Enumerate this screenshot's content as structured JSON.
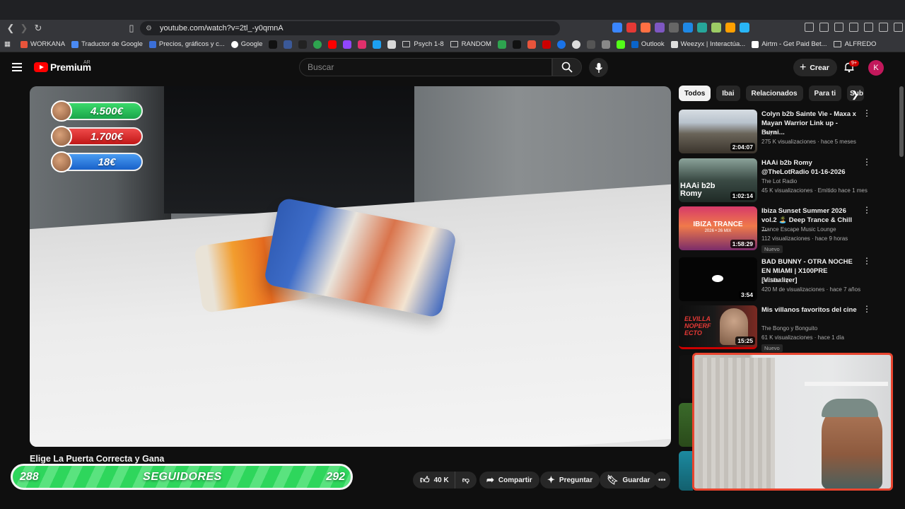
{
  "browser": {
    "url": "youtube.com/watch?v=2tl_-y0qmnA",
    "bookmarks": [
      {
        "label": "WORKANA",
        "color": "#e8543b"
      },
      {
        "label": "Traductor de Google",
        "color": "#4a8af4"
      },
      {
        "label": "Precios, gráficos y c...",
        "color": "#3b6fd8"
      },
      {
        "label": "Google",
        "color": "#ffffff"
      }
    ],
    "bookmark_icons": [
      "#000000",
      "#3b5998",
      "#111111",
      "#2ea44f",
      "#ff0000",
      "#9146ff",
      "#e1306c",
      "#1da1f2",
      "#d9d9d9"
    ],
    "bookmark_folder_1": "Psych 1-8",
    "bookmark_folder_2": "RANDOM",
    "bookmark_icons_2": [
      "#2ea44f",
      "#111111",
      "#e8543b",
      "#cc0000",
      "#1a73e8",
      "#dddddd",
      "#555555",
      "#888888",
      "#53fc18"
    ],
    "outlook": "Outlook",
    "weezyx": "Weezyx | Interactúa...",
    "airtm": "Airtm - Get Paid Bet...",
    "alfredo": "ALFREDO"
  },
  "header": {
    "logo": "Premium",
    "country": "AR",
    "search_placeholder": "Buscar",
    "create": "Crear",
    "notifications": "9+",
    "avatar_letter": "K"
  },
  "video": {
    "title": "Elige La Puerta Correcta y Gana",
    "scores": [
      "4.500€",
      "1.700€",
      "18€"
    ],
    "followers_left": "288",
    "followers_label": "SEGUIDORES",
    "followers_right": "292",
    "likes": "40 K",
    "share": "Compartir",
    "ask": "Preguntar",
    "save": "Guardar"
  },
  "chips": [
    "Todos",
    "Ibai",
    "Relacionados",
    "Para ti",
    "Sub"
  ],
  "recommendations": [
    {
      "title": "Colyn b2b Sainte Vie - Maxa x Mayan Warrior Link up - Burni...",
      "channel": "Colyn",
      "meta": "275 K visualizaciones · hace 5 meses",
      "duration": "2:04:07",
      "badge": ""
    },
    {
      "title": "HAAi b2b Romy @TheLotRadio 01-16-2026",
      "channel": "The Lot Radio",
      "meta": "45 K visualizaciones · Emitido hace 1 mes",
      "duration": "1:02:14",
      "badge": ""
    },
    {
      "title": "Ibiza Sunset Summer 2026 vol.2 🏝️ Deep Trance & Chill ...",
      "channel": "Trance Escape Music Lounge",
      "meta": "112 visualizaciones · hace 9 horas",
      "duration": "1:58:29",
      "badge": "Nuevo"
    },
    {
      "title": "BAD BUNNY - OTRA NOCHE EN MIAMI | X100PRE [Visualizer]",
      "channel": "Bad Bunny",
      "meta": "420 M de visualizaciones · hace 7 años",
      "duration": "3:54",
      "badge": ""
    },
    {
      "title": "Mis villanos favoritos del cine",
      "channel": "The Bongo y Bonguito",
      "meta": "61 K visualizaciones · hace 1 día",
      "duration": "15:25",
      "badge": "Nuevo"
    }
  ],
  "thumb_texts": [
    "HAAi b2b Romy",
    "IBIZA TRANCE",
    "2026 • 26 MIX",
    "ELVILLANOPERFECTO"
  ]
}
